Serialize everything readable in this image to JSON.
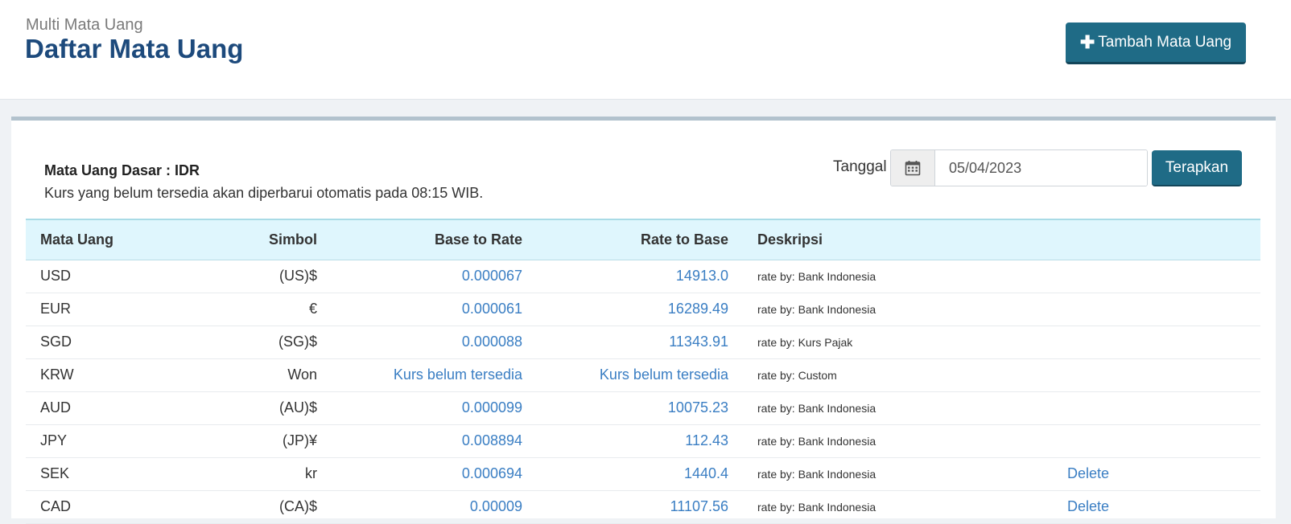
{
  "header": {
    "subtitle": "Multi Mata Uang",
    "title": "Daftar Mata Uang",
    "add_button_label": "Tambah Mata Uang",
    "add_button_icon": "plus-icon"
  },
  "info": {
    "base_currency_label": "Mata Uang Dasar : IDR",
    "auto_update_note": "Kurs yang belum tersedia akan diperbarui otomatis pada 08:15 WIB."
  },
  "filter": {
    "date_label": "Tanggal",
    "date_icon": "calendar-icon",
    "date_value": "05/04/2023",
    "apply_label": "Terapkan"
  },
  "table": {
    "columns": [
      "Mata Uang",
      "Simbol",
      "Base to Rate",
      "Rate to Base",
      "Deskripsi"
    ],
    "rows": [
      {
        "currency": "USD",
        "symbol": "(US)$",
        "base_to_rate": "0.000067",
        "rate_to_base": "14913.0",
        "desc_prefix": "rate by: ",
        "desc_source": "Bank Indonesia",
        "action": ""
      },
      {
        "currency": "EUR",
        "symbol": "€",
        "base_to_rate": "0.000061",
        "rate_to_base": "16289.49",
        "desc_prefix": "rate by: ",
        "desc_source": "Bank Indonesia",
        "action": ""
      },
      {
        "currency": "SGD",
        "symbol": "(SG)$",
        "base_to_rate": "0.000088",
        "rate_to_base": "11343.91",
        "desc_prefix": "rate by: ",
        "desc_source": "Kurs Pajak",
        "action": ""
      },
      {
        "currency": "KRW",
        "symbol": "Won",
        "base_to_rate": "Kurs belum tersedia",
        "rate_to_base": "Kurs belum tersedia",
        "desc_prefix": "rate by: ",
        "desc_source": "Custom",
        "action": ""
      },
      {
        "currency": "AUD",
        "symbol": "(AU)$",
        "base_to_rate": "0.000099",
        "rate_to_base": "10075.23",
        "desc_prefix": "rate by: ",
        "desc_source": "Bank Indonesia",
        "action": ""
      },
      {
        "currency": "JPY",
        "symbol": "(JP)¥",
        "base_to_rate": "0.008894",
        "rate_to_base": "112.43",
        "desc_prefix": "rate by: ",
        "desc_source": "Bank Indonesia",
        "action": ""
      },
      {
        "currency": "SEK",
        "symbol": "kr",
        "base_to_rate": "0.000694",
        "rate_to_base": "1440.4",
        "desc_prefix": "rate by: ",
        "desc_source": "Bank Indonesia",
        "action": "Delete"
      },
      {
        "currency": "CAD",
        "symbol": "(CA)$",
        "base_to_rate": "0.00009",
        "rate_to_base": "11107.56",
        "desc_prefix": "rate by: ",
        "desc_source": "Bank Indonesia",
        "action": "Delete"
      }
    ]
  },
  "colors": {
    "primary_button": "#1f6b86",
    "title": "#1d4a7c",
    "link": "#3a7ec3",
    "table_header_bg": "#dff6fd"
  }
}
